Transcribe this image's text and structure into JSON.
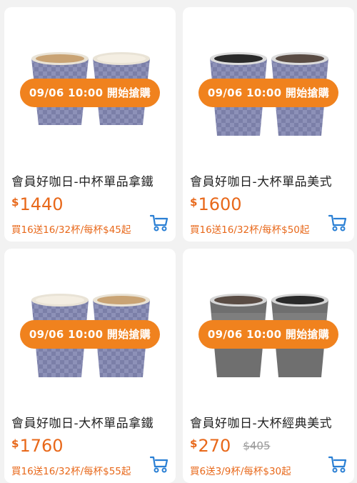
{
  "products": [
    {
      "title": "會員好咖日-中杯單品拿鐵",
      "sale_badge": "09/06 10:00 開始搶購",
      "currency": "$",
      "price": "1440",
      "original_price": "",
      "promo": "買16送16/32杯/每杯$45起",
      "cup_style": "purple-latte"
    },
    {
      "title": "會員好咖日-大杯單品美式",
      "sale_badge": "09/06 10:00 開始搶購",
      "currency": "$",
      "price": "1600",
      "original_price": "",
      "promo": "買16送16/32杯/每杯$50起",
      "cup_style": "purple-black"
    },
    {
      "title": "會員好咖日-大杯單品拿鐵",
      "sale_badge": "09/06 10:00 開始搶購",
      "currency": "$",
      "price": "1760",
      "original_price": "",
      "promo": "買16送16/32杯/每杯$55起",
      "cup_style": "purple-latte"
    },
    {
      "title": "會員好咖日-大杯經典美式",
      "sale_badge": "09/06 10:00 開始搶購",
      "currency": "$",
      "price": "270",
      "original_price": "$405",
      "promo": "買6送3/9杯/每杯$30起",
      "cup_style": "gray-black"
    }
  ],
  "colors": {
    "accent": "#f0821e",
    "price": "#e8681a",
    "cart_icon": "#2a7fd4",
    "cup_purple": "#7b7fa8",
    "cup_gray": "#6f6f6f"
  }
}
